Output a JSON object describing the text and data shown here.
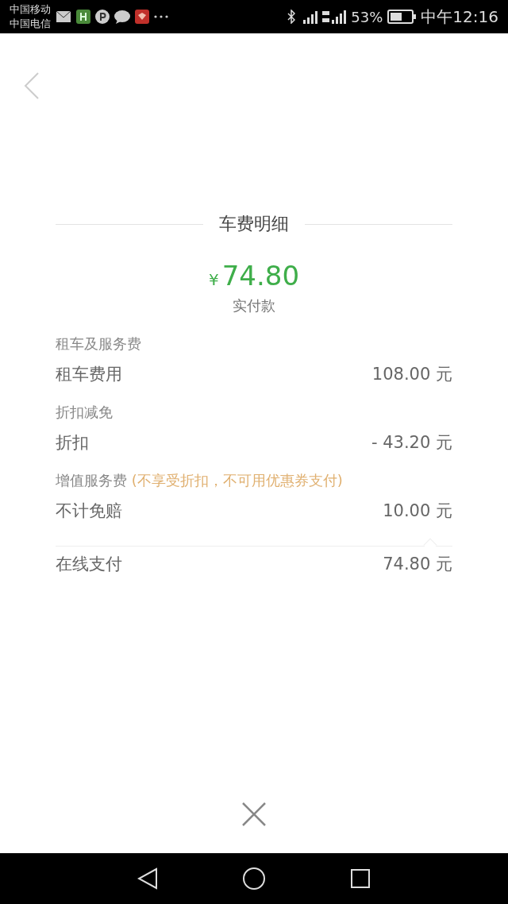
{
  "status_bar": {
    "carriers": [
      "中国移动",
      "中国电信"
    ],
    "battery_percent": "53%",
    "time": "中午12:16"
  },
  "fare": {
    "title": "车费明细",
    "currency": "¥",
    "amount": "74.80",
    "amount_label": "实付款",
    "sections": [
      {
        "heading": "租车及服务费",
        "rows": [
          {
            "label": "租车费用",
            "value": "108.00 元"
          }
        ]
      },
      {
        "heading": "折扣减免",
        "rows": [
          {
            "label": "折扣",
            "value": "- 43.20 元"
          }
        ]
      },
      {
        "heading": "增值服务费",
        "note": "(不享受折扣，不可用优惠券支付)",
        "rows": [
          {
            "label": "不计免赔",
            "value": "10.00 元"
          }
        ]
      }
    ],
    "total": {
      "label": "在线支付",
      "value": "74.80 元"
    }
  }
}
